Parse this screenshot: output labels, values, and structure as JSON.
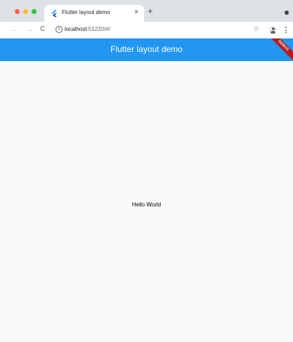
{
  "browser": {
    "tab": {
      "title": "Flutter layout demo",
      "close_glyph": "×",
      "favicon": "flutter-icon"
    },
    "new_tab_glyph": "+",
    "nav": {
      "back": "←",
      "forward": "→",
      "reload": "C"
    },
    "address": {
      "host": "localhost",
      "rest": ":51220/#/"
    },
    "icons": [
      "info-icon",
      "star-icon",
      "profile-icon",
      "menu-icon"
    ],
    "star_glyph": "☆"
  },
  "app": {
    "appbar_title": "Flutter layout demo",
    "appbar_color": "#2196f3",
    "debug_banner": "DEBUG",
    "body_text": "Hello World"
  }
}
